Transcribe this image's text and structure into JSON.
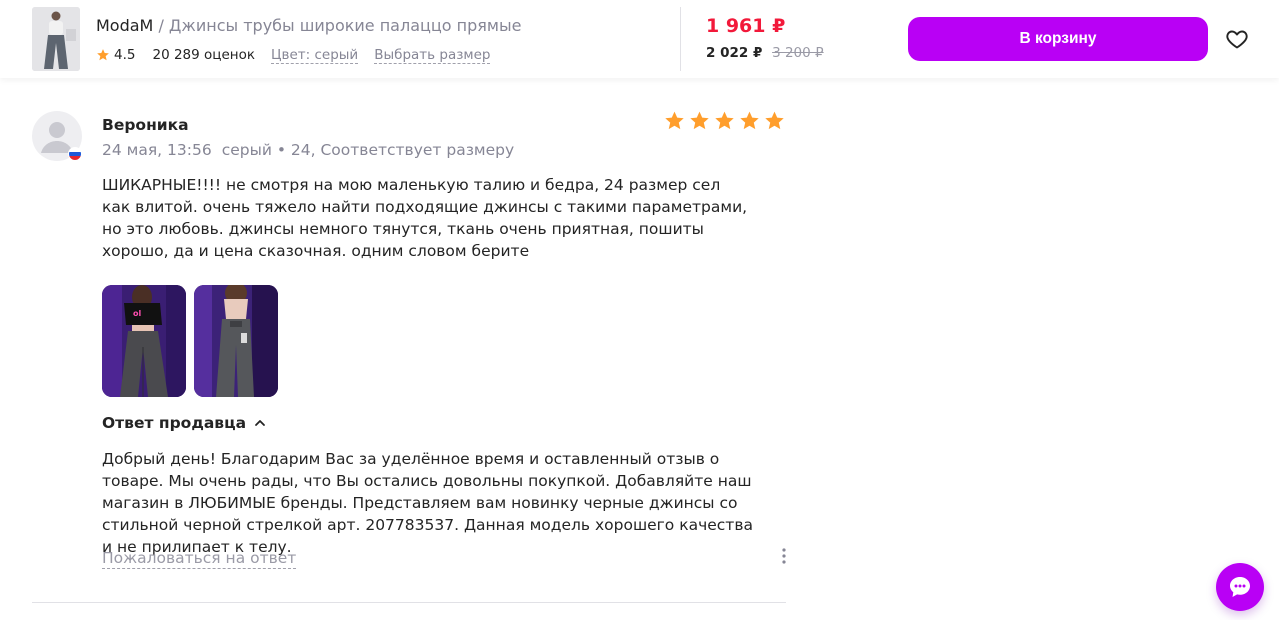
{
  "product": {
    "brand": "ModaM",
    "separator": " / ",
    "name": "Джинсы трубы широкие палаццо прямые",
    "rating": "4.5",
    "ratings_count": "20 289 оценок",
    "color_link": "Цвет: серый",
    "size_link": "Выбрать размер",
    "price": "1 961 ₽",
    "wallet_price": "2 022 ₽",
    "old_price": "3 200 ₽",
    "cart_button": "В корзину",
    "icons": {
      "favorite": "heart-outline-icon",
      "rating": "star-icon"
    }
  },
  "review": {
    "author": "Вероника",
    "date": "24 мая, 13:56",
    "details": "серый • 24, Соответствует размеру",
    "stars": 5,
    "text": "ШИКАРНЫЕ!!!! не смотря на мою маленькую талию и бедра, 24 размер сел как влитой. очень тяжело найти подходящие джинсы с такими параметрами, но это любовь. джинсы немного тянутся, ткань очень приятная, пошиты хорошо, да и цена сказочная. одним словом берите",
    "photos_count": 2,
    "seller_reply_label": "Ответ продавца",
    "seller_reply": "Добрый день! Благодарим Вас за уделённое время и оставленный отзыв о товаре. Мы очень рады, что Вы остались довольны покупкой. Добавляйте наш магазин в ЛЮБИМЫЕ бренды. Представляем вам новинку черные джинсы со стильной черной стрелкой арт. 207783537. Данная модель хорошего качества и не прилипает к телу.",
    "complain_link": "Пожаловаться на ответ"
  },
  "colors": {
    "accent": "#b900f5",
    "price": "#f2193a",
    "star": "#ff9e2c",
    "muted": "#868695"
  }
}
